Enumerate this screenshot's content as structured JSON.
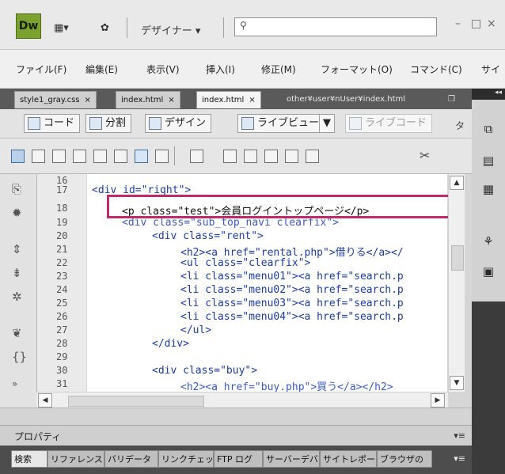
{
  "app": {
    "logo": "Dw",
    "workspace_label": "デザイナー ▾",
    "layout_icon": "▦▾",
    "gear_icon": "✿",
    "search_placeholder": "",
    "window_controls": [
      "–",
      "□",
      "×"
    ]
  },
  "menubar": {
    "items": [
      "ファイル(F)",
      "編集(E)",
      "表示(V)",
      "挿入(I)",
      "修正(M)",
      "フォーマット(O)",
      "コマンド(C)",
      "サイ"
    ]
  },
  "tabs": {
    "items": [
      {
        "label": "style1_gray.css",
        "close": "×"
      },
      {
        "label": "index.html",
        "close": "×"
      },
      {
        "label": "index.html",
        "close": "×"
      }
    ],
    "path": "other¥user¥nUser¥index.html",
    "path_icon": "❐"
  },
  "doc_toolbar": {
    "code": "コード",
    "split": "分割",
    "design": "デザイン",
    "live_view": "ライブビュー",
    "live_code": "ライブコード",
    "dropdown": "▼"
  },
  "code": {
    "line_numbers": [
      "16",
      "17",
      "18",
      "19",
      "20",
      "21",
      "22",
      "23",
      "24",
      "25",
      "26",
      "27",
      "28",
      "29",
      "30",
      "31"
    ],
    "lines": [
      {
        "text": "<div id=\"right\">"
      },
      {
        "text": "<p class=\"test\">会員ログイントップページ</p>"
      },
      {
        "text": "<div class=\"sub_top_navi clearfix\">"
      },
      {
        "text": "<div class=\"rent\">"
      },
      {
        "text": "<h2><a href=\"rental.php\">借りる</a></"
      },
      {
        "text": "<ul class=\"clearfix\">"
      },
      {
        "text": "<li class=\"menu01\"><a href=\"search.p"
      },
      {
        "text": "<li class=\"menu02\"><a href=\"search.p"
      },
      {
        "text": "<li class=\"menu03\"><a href=\"search.p"
      },
      {
        "text": "<li class=\"menu04\"><a href=\"search.p"
      },
      {
        "text": "</ul>"
      },
      {
        "text": "</div>"
      },
      {
        "text": "<div class=\"buy\">"
      },
      {
        "text": "<h2><a href=\"buy.php\">買う</a></h2>"
      }
    ]
  },
  "properties": {
    "title": "プロパティ",
    "menu": "▾≡"
  },
  "bottom_tabs": {
    "items": [
      "検索",
      "リファレンス",
      "バリデータ",
      "リンクチェッカー",
      "FTP ログ",
      "サーバーデバッグ",
      "サイトレポート",
      "ブラウザの"
    ],
    "menu": "▾≡"
  },
  "right_dock": {
    "collapse": "◂◂"
  }
}
